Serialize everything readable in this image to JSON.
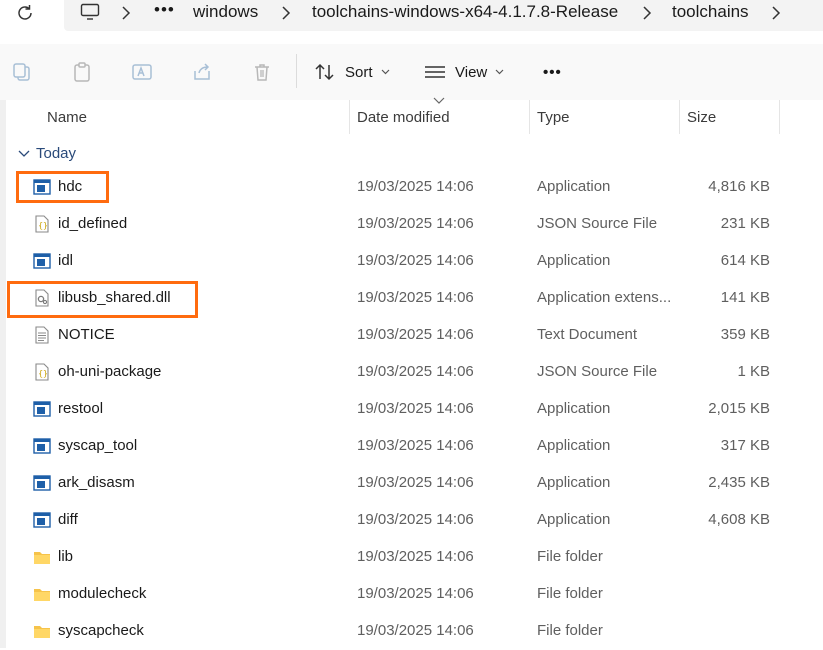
{
  "breadcrumbs": [
    "windows",
    "toolchains-windows-x64-4.1.7.8-Release",
    "toolchains"
  ],
  "toolbar": {
    "sort_label": "Sort",
    "view_label": "View",
    "more_label": "•••"
  },
  "columns": {
    "name": "Name",
    "date": "Date modified",
    "type": "Type",
    "size": "Size"
  },
  "group_label": "Today",
  "files": [
    {
      "name": "hdc",
      "date": "19/03/2025 14:06",
      "type": "Application",
      "size": "4,816 KB",
      "icon": "application-icon"
    },
    {
      "name": "id_defined",
      "date": "19/03/2025 14:06",
      "type": "JSON Source File",
      "size": "231 KB",
      "icon": "json-file-icon"
    },
    {
      "name": "idl",
      "date": "19/03/2025 14:06",
      "type": "Application",
      "size": "614 KB",
      "icon": "application-icon"
    },
    {
      "name": "libusb_shared.dll",
      "date": "19/03/2025 14:06",
      "type": "Application extens...",
      "size": "141 KB",
      "icon": "dll-file-icon"
    },
    {
      "name": "NOTICE",
      "date": "19/03/2025 14:06",
      "type": "Text Document",
      "size": "359 KB",
      "icon": "text-file-icon"
    },
    {
      "name": "oh-uni-package",
      "date": "19/03/2025 14:06",
      "type": "JSON Source File",
      "size": "1 KB",
      "icon": "json-file-icon"
    },
    {
      "name": "restool",
      "date": "19/03/2025 14:06",
      "type": "Application",
      "size": "2,015 KB",
      "icon": "application-icon"
    },
    {
      "name": "syscap_tool",
      "date": "19/03/2025 14:06",
      "type": "Application",
      "size": "317 KB",
      "icon": "application-icon"
    },
    {
      "name": "ark_disasm",
      "date": "19/03/2025 14:06",
      "type": "Application",
      "size": "2,435 KB",
      "icon": "application-icon"
    },
    {
      "name": "diff",
      "date": "19/03/2025 14:06",
      "type": "Application",
      "size": "4,608 KB",
      "icon": "application-icon"
    },
    {
      "name": "lib",
      "date": "19/03/2025 14:06",
      "type": "File folder",
      "size": "",
      "icon": "folder-icon"
    },
    {
      "name": "modulecheck",
      "date": "19/03/2025 14:06",
      "type": "File folder",
      "size": "",
      "icon": "folder-icon"
    },
    {
      "name": "syscapcheck",
      "date": "19/03/2025 14:06",
      "type": "File folder",
      "size": "",
      "icon": "folder-icon"
    }
  ],
  "colors": {
    "highlight": "#ff6b0f",
    "app_icon": "#1e5fa8",
    "folder": "#f6c34a"
  }
}
